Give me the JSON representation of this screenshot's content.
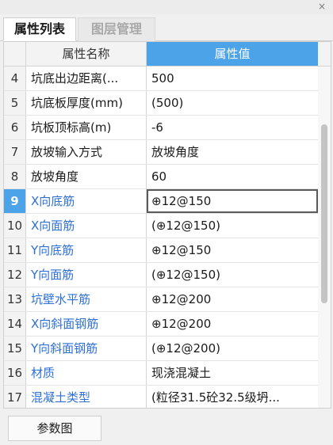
{
  "window": {
    "close_glyph": "×"
  },
  "tabs": [
    {
      "label": "属性列表",
      "active": true
    },
    {
      "label": "图层管理",
      "active": false
    }
  ],
  "grid": {
    "header": {
      "name": "属性名称",
      "value": "属性值"
    },
    "rows": [
      {
        "num": "4",
        "name": "坑底出边距离(...",
        "value": "500",
        "name_color": "default"
      },
      {
        "num": "5",
        "name": "坑底板厚度(mm)",
        "value": "(500)",
        "name_color": "default"
      },
      {
        "num": "6",
        "name": "坑板顶标高(m)",
        "value": "-6",
        "name_color": "default"
      },
      {
        "num": "7",
        "name": "放坡输入方式",
        "value": "放坡角度",
        "name_color": "default"
      },
      {
        "num": "8",
        "name": "放坡角度",
        "value": "60",
        "name_color": "default"
      },
      {
        "num": "9",
        "name": "X向底筋",
        "value": "⊕12@150",
        "name_color": "blue",
        "selected": true
      },
      {
        "num": "10",
        "name": "X向面筋",
        "value": "(⊕12@150)",
        "name_color": "blue"
      },
      {
        "num": "11",
        "name": "Y向底筋",
        "value": "⊕12@150",
        "name_color": "blue"
      },
      {
        "num": "12",
        "name": "Y向面筋",
        "value": "(⊕12@150)",
        "name_color": "blue"
      },
      {
        "num": "13",
        "name": "坑壁水平筋",
        "value": "⊕12@200",
        "name_color": "blue"
      },
      {
        "num": "14",
        "name": "X向斜面钢筋",
        "value": "⊕12@200",
        "name_color": "blue"
      },
      {
        "num": "15",
        "name": "Y向斜面钢筋",
        "value": "(⊕12@200)",
        "name_color": "blue"
      },
      {
        "num": "16",
        "name": "材质",
        "value": "现浇混凝土",
        "name_color": "blue"
      },
      {
        "num": "17",
        "name": "混凝土类型",
        "value": "(粒径31.5砼32.5级坍...",
        "name_color": "blue"
      }
    ]
  },
  "footer": {
    "param_button": "参数图"
  },
  "colors": {
    "accent": "#4da3e8",
    "link_blue": "#2e6fd6"
  }
}
